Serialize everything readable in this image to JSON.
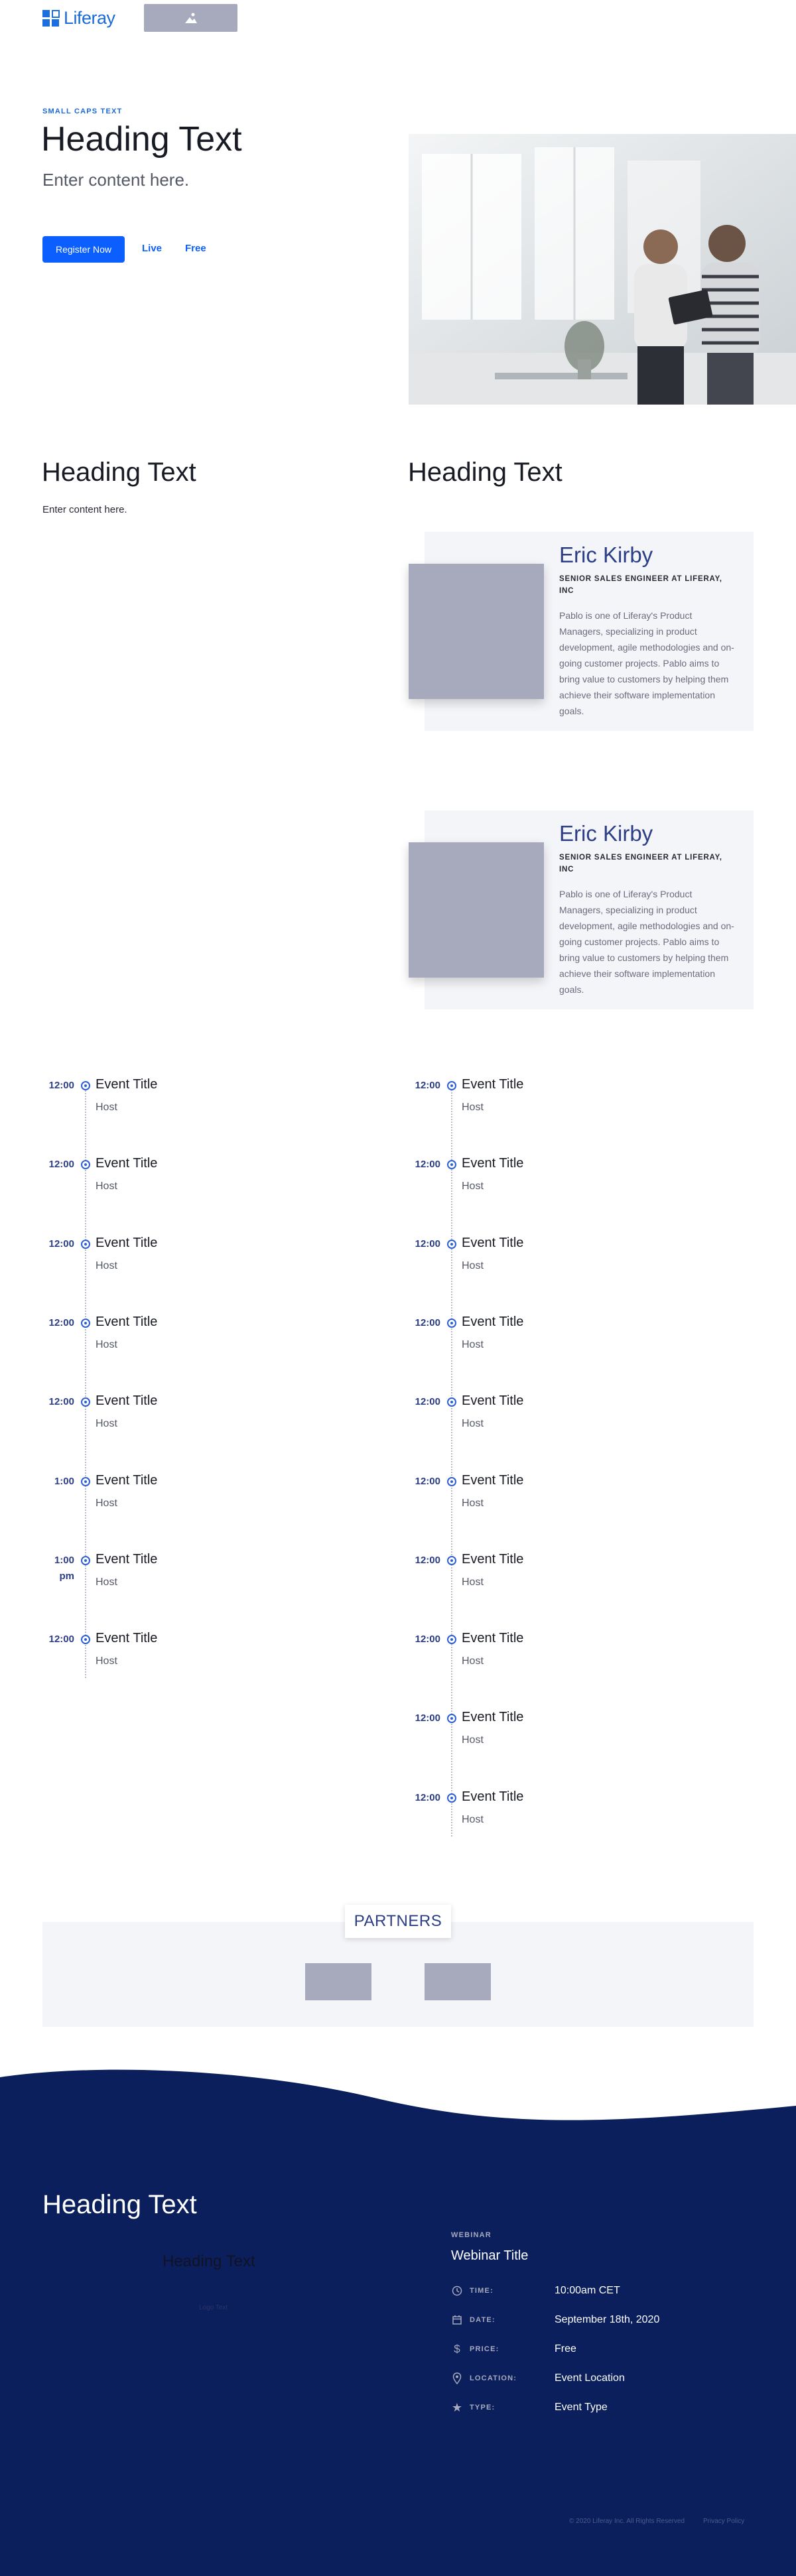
{
  "header": {
    "logo_text": "Liferay",
    "image_placeholder_icon": "image-icon"
  },
  "hero": {
    "kicker": "SMALL CAPS TEXT",
    "heading": "Heading Text",
    "subheading": "Enter content here.",
    "register_label": "Register Now",
    "badge_live": "Live",
    "badge_free": "Free"
  },
  "intro": {
    "left_heading": "Heading Text",
    "left_body": "Enter content here.",
    "right_heading": "Heading Text"
  },
  "speakers": [
    {
      "name": "Eric Kirby",
      "role": "SENIOR SALES ENGINEER AT LIFERAY, INC",
      "bio": "Pablo is one of Liferay's Product Managers, specializing in product development, agile methodologies and on-going customer projects. Pablo aims to bring value to customers by helping them achieve their software implementation goals."
    },
    {
      "name": "Eric Kirby",
      "role": "SENIOR SALES ENGINEER AT LIFERAY, INC",
      "bio": "Pablo is one of Liferay's Product Managers, specializing in product development, agile methodologies and on-going customer projects. Pablo aims to bring value to customers by helping them achieve their software implementation goals."
    }
  ],
  "schedule_left": [
    {
      "time": "12:00",
      "title": "Event Title",
      "host": "Host"
    },
    {
      "time": "12:00",
      "title": "Event Title",
      "host": "Host"
    },
    {
      "time": "12:00",
      "title": "Event Title",
      "host": "Host"
    },
    {
      "time": "12:00",
      "title": "Event Title",
      "host": "Host"
    },
    {
      "time": "12:00",
      "title": "Event Title",
      "host": "Host"
    },
    {
      "time": "1:00",
      "title": "Event Title",
      "host": "Host"
    },
    {
      "time": "1:00 pm",
      "title": "Event Title",
      "host": "Host"
    },
    {
      "time": "12:00",
      "title": "Event Title",
      "host": "Host"
    }
  ],
  "schedule_right": [
    {
      "time": "12:00",
      "title": "Event Title",
      "host": "Host"
    },
    {
      "time": "12:00",
      "title": "Event Title",
      "host": "Host"
    },
    {
      "time": "12:00",
      "title": "Event Title",
      "host": "Host"
    },
    {
      "time": "12:00",
      "title": "Event Title",
      "host": "Host"
    },
    {
      "time": "12:00",
      "title": "Event Title",
      "host": "Host"
    },
    {
      "time": "12:00",
      "title": "Event Title",
      "host": "Host"
    },
    {
      "time": "12:00",
      "title": "Event Title",
      "host": "Host"
    },
    {
      "time": "12:00",
      "title": "Event Title",
      "host": "Host"
    },
    {
      "time": "12:00",
      "title": "Event Title",
      "host": "Host"
    },
    {
      "time": "12:00",
      "title": "Event Title",
      "host": "Host"
    }
  ],
  "partners": {
    "label": "PARTNERS"
  },
  "footer": {
    "heading": "Heading Text",
    "ghost_heading": "Heading Text",
    "ghost_logo_text": "Logo Text",
    "webinar_kicker": "WEBINAR",
    "webinar_title": "Webinar Title",
    "details": [
      {
        "icon": "clock-icon",
        "label": "TIME:",
        "value": "10:00am CET"
      },
      {
        "icon": "calendar-icon",
        "label": "DATE:",
        "value": "September 18th, 2020"
      },
      {
        "icon": "dollar-icon",
        "label": "PRICE:",
        "value": "Free"
      },
      {
        "icon": "location-pin-icon",
        "label": "LOCATION:",
        "value": "Event Location"
      },
      {
        "icon": "star-icon",
        "label": "TYPE:",
        "value": "Event Type"
      }
    ],
    "copyright": "© 2020 Liferay Inc. All Rights Reserved",
    "privacy": "Privacy Policy"
  },
  "colors": {
    "primary": "#0b5fff",
    "navy": "#0a1f5c",
    "speaker_name": "#2c3e86",
    "card_bg": "#f4f5f9",
    "placeholder": "#a7a9bc"
  }
}
